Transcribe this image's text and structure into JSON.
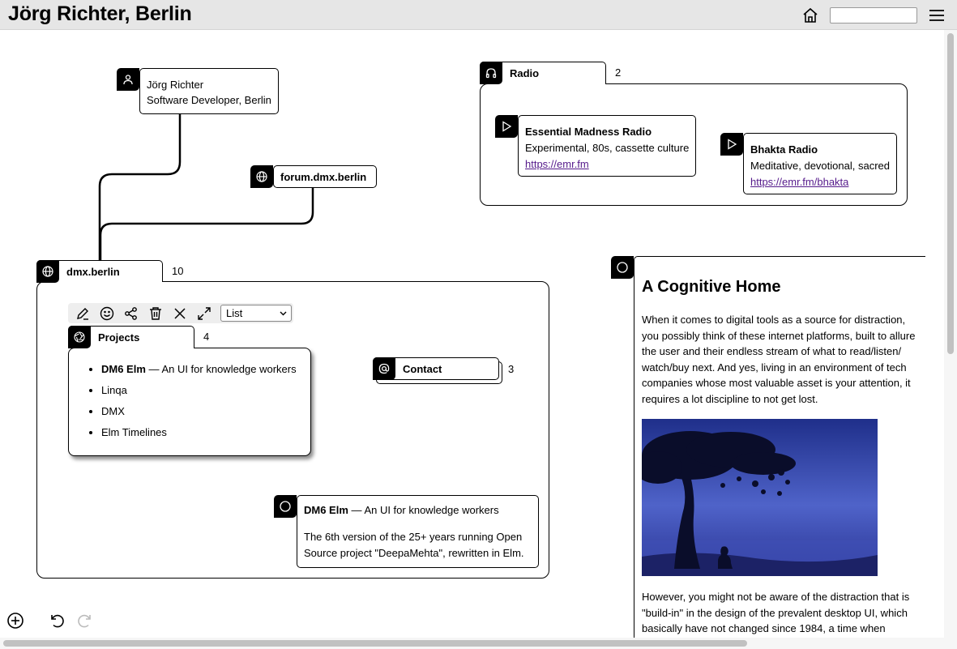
{
  "header": {
    "title": "Jörg Richter, Berlin",
    "search_value": "",
    "icons": [
      "home-icon",
      "hamburger-menu-icon"
    ]
  },
  "person": {
    "name": "Jörg Richter",
    "role": "Software Developer, Berlin",
    "icon": "user-icon"
  },
  "forum": {
    "label": "forum.dmx.berlin",
    "icon": "globe-icon"
  },
  "radio": {
    "label": "Radio",
    "count": "2",
    "icon": "headphones-icon",
    "items": [
      {
        "title": "Essential Madness Radio",
        "desc": "Experimental, 80s, cassette culture",
        "url": "https://emr.fm",
        "icon": "play-icon"
      },
      {
        "title": "Bhakta Radio",
        "desc": "Meditative, devotional, sacred",
        "url": "https://emr.fm/bhakta",
        "icon": "play-icon"
      }
    ]
  },
  "dmx": {
    "label": "dmx.berlin",
    "count": "10",
    "icon": "globe-icon",
    "toolbar": {
      "icons": [
        "edit-icon",
        "emoji-icon",
        "share-icon",
        "trash-icon",
        "close-icon",
        "fullscreen-icon"
      ],
      "view_select": "List"
    },
    "projects": {
      "label": "Projects",
      "count": "4",
      "icon": "aperture-icon",
      "items": [
        {
          "title": "DM6 Elm",
          "sep": "—",
          "desc": "An UI for knowledge workers"
        },
        {
          "title": "Linqa"
        },
        {
          "title": "DMX"
        },
        {
          "title": "Elm Timelines"
        }
      ]
    },
    "contact": {
      "label": "Contact",
      "count": "3",
      "icon": "at-icon"
    },
    "dm6": {
      "title": "DM6 Elm",
      "sep": "—",
      "desc": "An UI for knowledge workers",
      "body": "The 6th version of the 25+ years running Open Source project \"DeepaMehta\", rewritten in Elm.",
      "icon": "circle-icon"
    }
  },
  "article": {
    "icon": "circle-icon",
    "title": "A Cognitive Home",
    "p1": "When it comes to digital tools as a source for distraction, you possibly think of these internet platforms, built to allure the user and their endless stream of what to read/listen/ watch/buy next. And yes, living in an environment of tech companies whose most valuable asset is your attention, it requires a lot discipline to not get lost.",
    "p2": "However, you might not be aware of the distraction that is \"build-in\" in the design of the prevalent desktop UI, which basically have not changed since 1984, a time when"
  },
  "bottom": {
    "icons": [
      "add-icon",
      "undo-icon",
      "redo-icon"
    ]
  }
}
